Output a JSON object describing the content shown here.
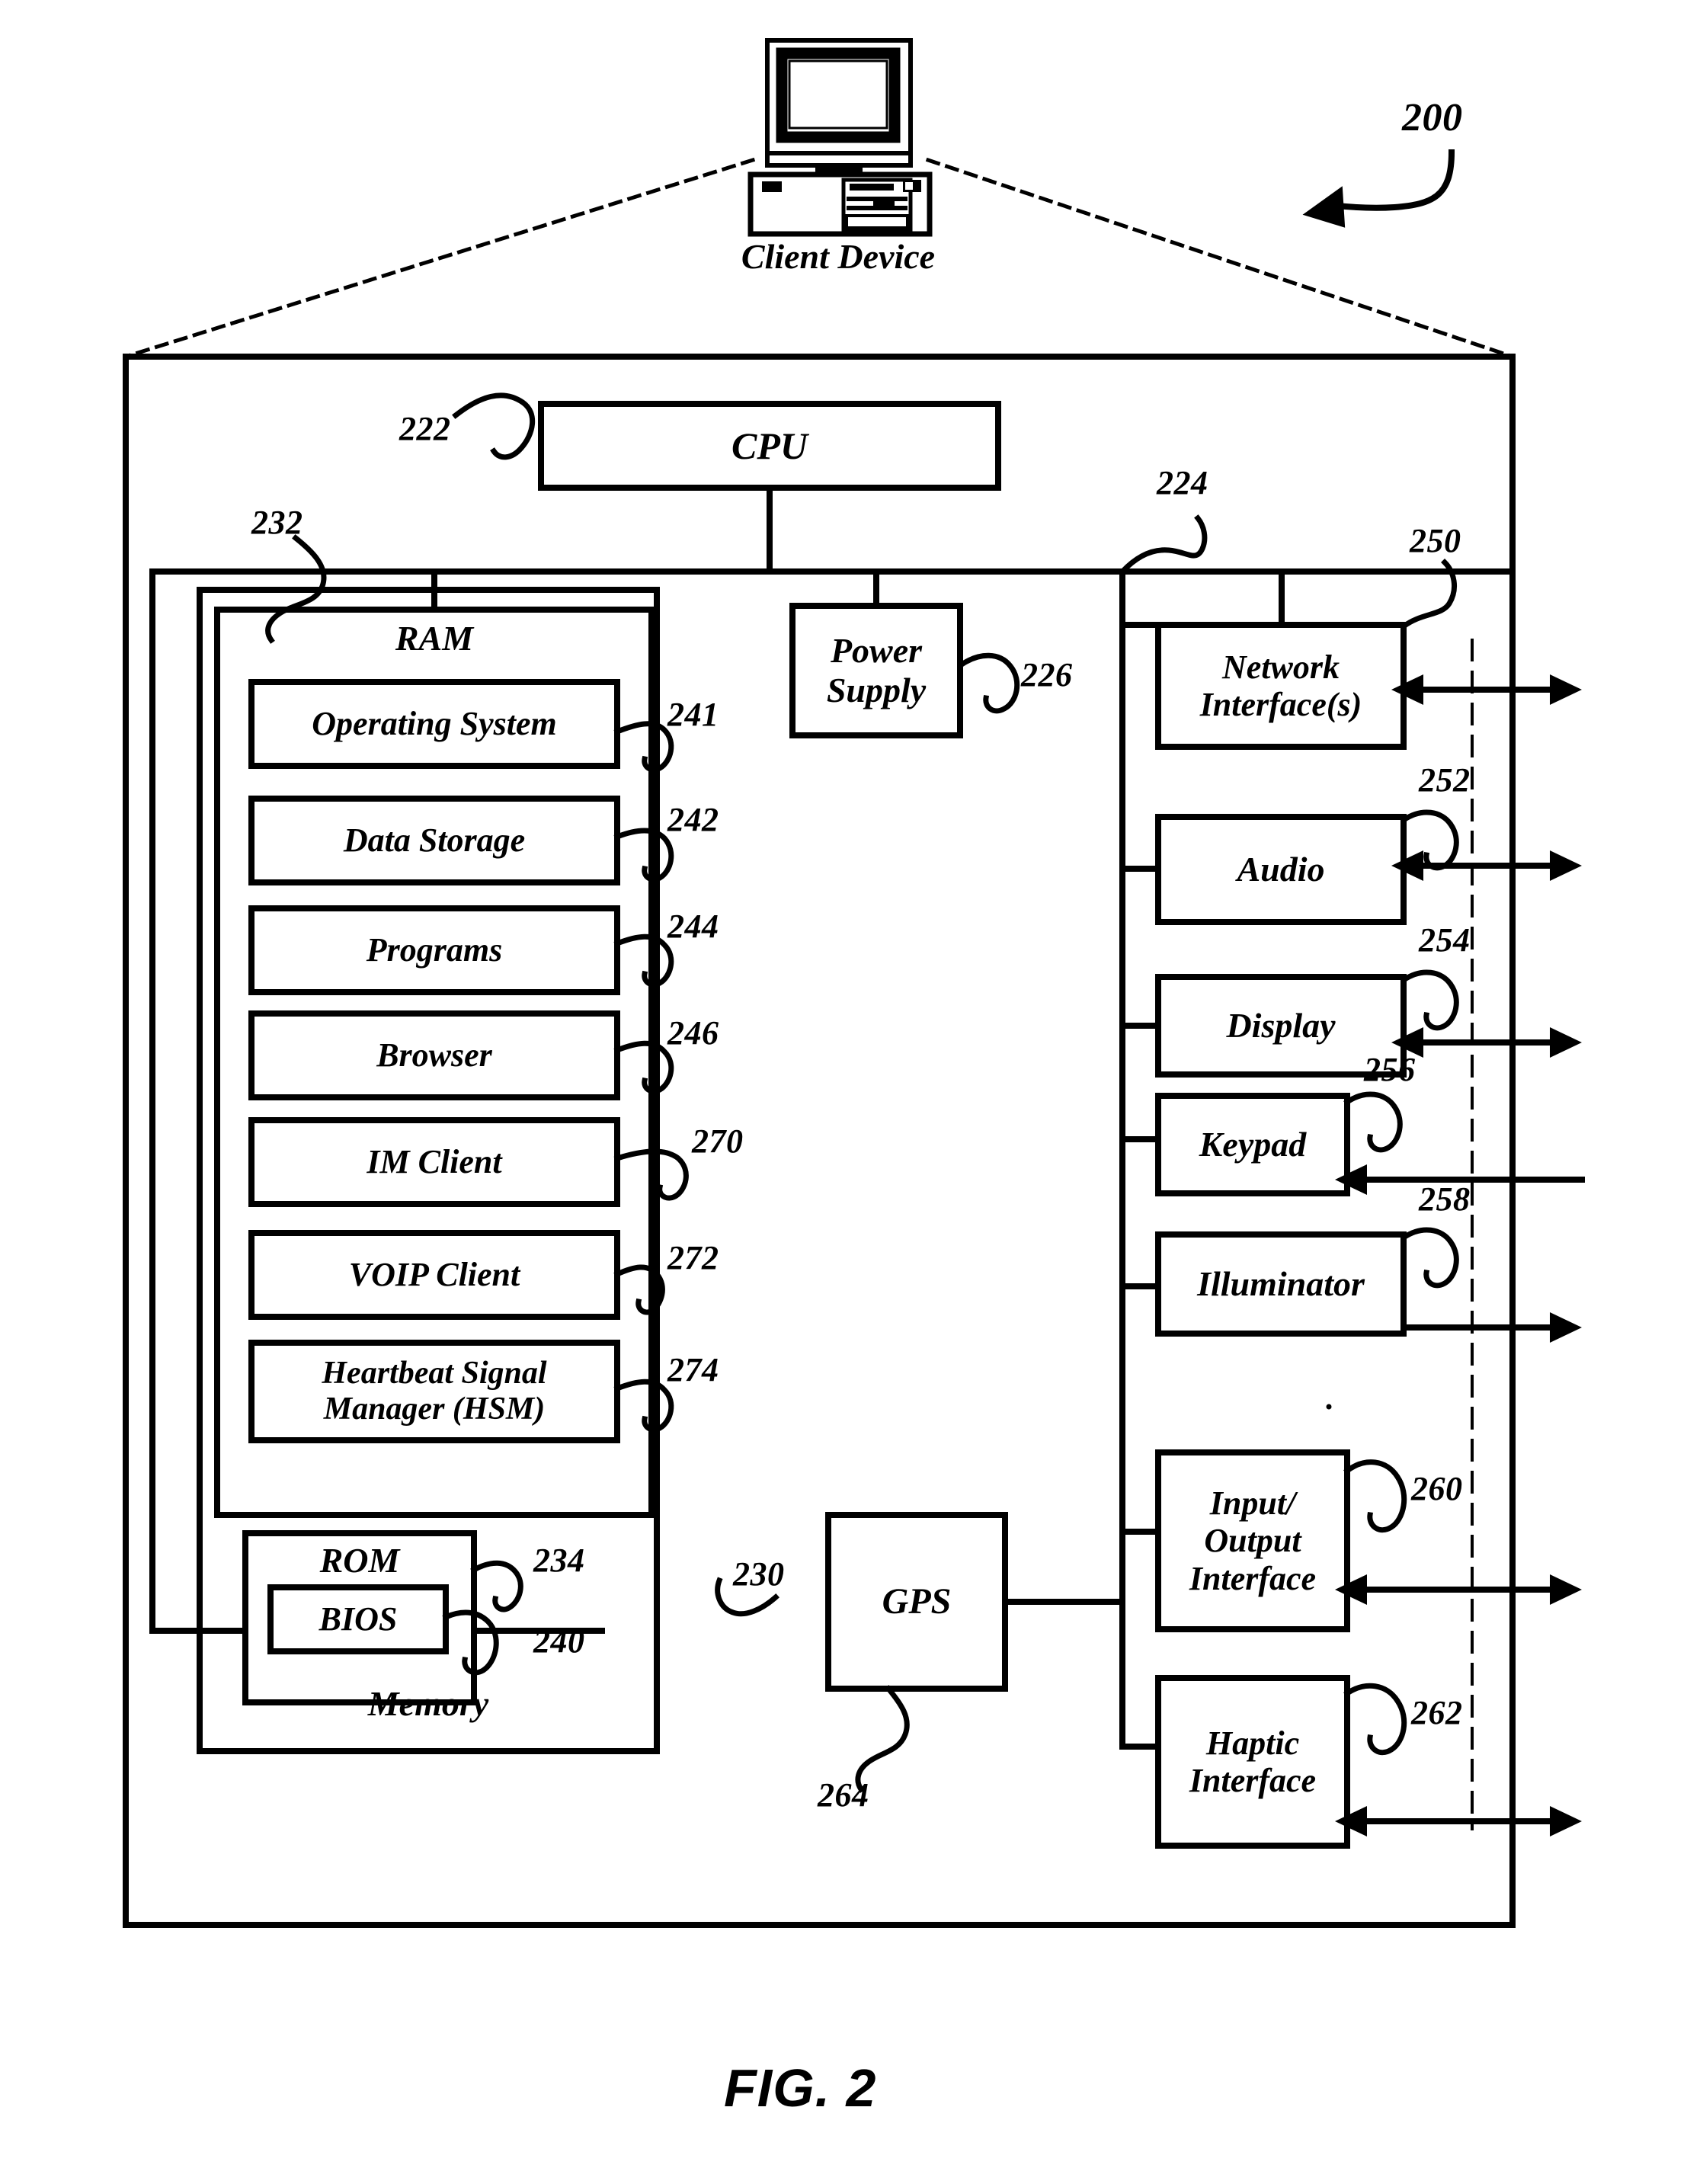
{
  "figure": {
    "caption": "FIG. 2",
    "system_ref": "200",
    "client_device_label": "Client Device"
  },
  "blocks": {
    "cpu": {
      "label": "CPU",
      "ref": "222"
    },
    "power_supply": {
      "label": "Power\nSupply",
      "ref": "226"
    },
    "gps": {
      "label": "GPS",
      "ref": "264"
    },
    "memory": {
      "label": "Memory",
      "ref": "230"
    },
    "bus": {
      "ref": "232"
    },
    "io_bus": {
      "ref": "224"
    },
    "ram": {
      "label": "RAM"
    },
    "rom": {
      "label": "ROM",
      "ref": "234"
    },
    "bios": {
      "label": "BIOS",
      "ref": "240"
    }
  },
  "ram_items": [
    {
      "label": "Operating System",
      "ref": "241"
    },
    {
      "label": "Data Storage",
      "ref": "242"
    },
    {
      "label": "Programs",
      "ref": "244"
    },
    {
      "label": "Browser",
      "ref": "246"
    },
    {
      "label": "IM Client",
      "ref": "270"
    },
    {
      "label": "VOIP Client",
      "ref": "272"
    },
    {
      "label": "Heartbeat Signal\nManager (HSM)",
      "ref": "274"
    }
  ],
  "io_items": [
    {
      "label": "Network\nInterface(s)",
      "ref": "250"
    },
    {
      "label": "Audio",
      "ref": "252"
    },
    {
      "label": "Display",
      "ref": "254"
    },
    {
      "label": "Keypad",
      "ref": "256"
    },
    {
      "label": "Illuminator",
      "ref": "258"
    },
    {
      "label": "Input/\nOutput\nInterface",
      "ref": "260"
    },
    {
      "label": "Haptic\nInterface",
      "ref": "262"
    }
  ],
  "colors": {
    "ink": "#000000",
    "paper": "#ffffff"
  }
}
